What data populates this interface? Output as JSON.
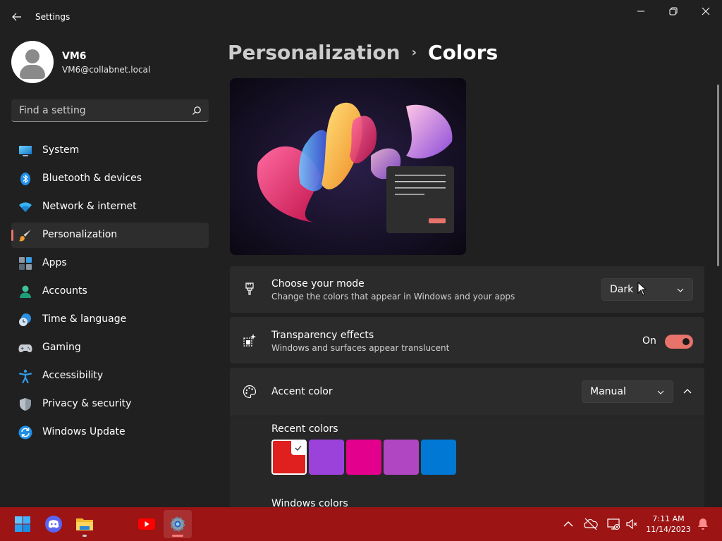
{
  "window": {
    "title": "Settings",
    "minimize_glyph": "—",
    "maximize_glyph": "❐",
    "close_glyph": "✕"
  },
  "user": {
    "name": "VM6",
    "email": "VM6@collabnet.local"
  },
  "search": {
    "placeholder": "Find a setting"
  },
  "nav": [
    {
      "label": "System",
      "icon": "system-icon"
    },
    {
      "label": "Bluetooth & devices",
      "icon": "bluetooth-icon"
    },
    {
      "label": "Network & internet",
      "icon": "wifi-icon"
    },
    {
      "label": "Personalization",
      "icon": "brush-icon",
      "selected": true
    },
    {
      "label": "Apps",
      "icon": "apps-icon"
    },
    {
      "label": "Accounts",
      "icon": "accounts-icon"
    },
    {
      "label": "Time & language",
      "icon": "clock-globe-icon"
    },
    {
      "label": "Gaming",
      "icon": "gamepad-icon"
    },
    {
      "label": "Accessibility",
      "icon": "accessibility-icon"
    },
    {
      "label": "Privacy & security",
      "icon": "shield-icon"
    },
    {
      "label": "Windows Update",
      "icon": "update-icon"
    }
  ],
  "breadcrumb": {
    "parent": "Personalization",
    "separator": "›",
    "current": "Colors"
  },
  "mode": {
    "title": "Choose your mode",
    "subtitle": "Change the colors that appear in Windows and your apps",
    "value": "Dark"
  },
  "transparency": {
    "title": "Transparency effects",
    "subtitle": "Windows and surfaces appear translucent",
    "state_label": "On",
    "enabled": true
  },
  "accent": {
    "title": "Accent color",
    "value": "Manual",
    "expanded": true,
    "recent_label": "Recent colors",
    "recent_colors": [
      "#e01f1f",
      "#9b42db",
      "#e3008c",
      "#b146c2",
      "#0078d4"
    ],
    "selected_index": 0,
    "windows_colors_label": "Windows colors"
  },
  "taskbar": {
    "apps": [
      "start-icon",
      "discord-icon",
      "file-explorer-icon",
      "youtube-icon",
      "settings-icon"
    ],
    "active_app": "settings-icon",
    "clock_time": "7:11 AM",
    "clock_date": "11/14/2023",
    "color": "#9c1414"
  },
  "colors": {
    "accent": "#e8736b",
    "background": "#202020",
    "card": "#2b2b2b"
  }
}
